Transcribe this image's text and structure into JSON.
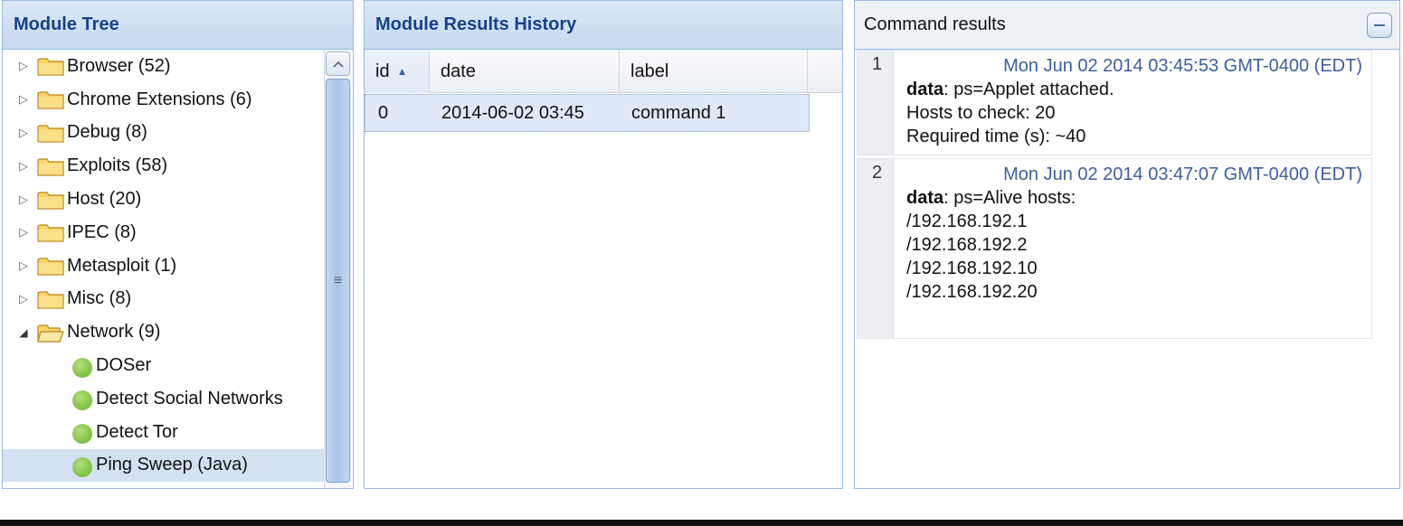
{
  "module_tree": {
    "title": "Module Tree",
    "folders": [
      {
        "label": "Browser (52)"
      },
      {
        "label": "Chrome Extensions (6)"
      },
      {
        "label": "Debug (8)"
      },
      {
        "label": "Exploits (58)"
      },
      {
        "label": "Host (20)"
      },
      {
        "label": "IPEC (8)"
      },
      {
        "label": "Metasploit (1)"
      },
      {
        "label": "Misc (8)"
      },
      {
        "label": "Network (9)"
      }
    ],
    "network_children": [
      {
        "label": "DOSer"
      },
      {
        "label": "Detect Social Networks"
      },
      {
        "label": "Detect Tor"
      },
      {
        "label": "Ping Sweep (Java)"
      }
    ],
    "selected": "Ping Sweep (Java)"
  },
  "history": {
    "title": "Module Results History",
    "columns": {
      "id": "id",
      "date": "date",
      "label": "label"
    },
    "rows": [
      {
        "id": "0",
        "date": "2014-06-02 03:45",
        "label": "command 1"
      }
    ]
  },
  "command_results": {
    "title": "Command results",
    "results": [
      {
        "num": "1",
        "date": "Mon Jun 02 2014 03:45:53 GMT-0400 (EDT)",
        "data_key": "data",
        "data_value": ": ps=Applet attached.",
        "lines": [
          "Hosts to check: 20",
          "Required time (s): ~40"
        ]
      },
      {
        "num": "2",
        "date": "Mon Jun 02 2014 03:47:07 GMT-0400 (EDT)",
        "data_key": "data",
        "data_value": ": ps=Alive hosts:",
        "lines": [
          "/192.168.192.1",
          "/192.168.192.2",
          "/192.168.192.10",
          "/192.168.192.20"
        ]
      }
    ]
  },
  "icons": {
    "folder": "folder-icon",
    "folder_open": "folder-open-icon",
    "leaf": "green-dot-icon",
    "collapse": "minus-icon"
  }
}
